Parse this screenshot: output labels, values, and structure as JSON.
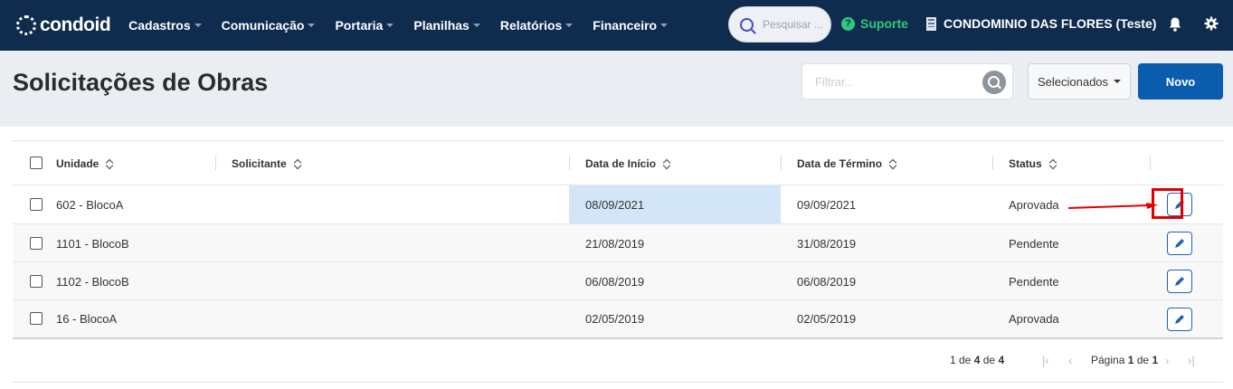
{
  "nav": {
    "logo": "condoid",
    "menu": [
      {
        "label": "Cadastros"
      },
      {
        "label": "Comunicação"
      },
      {
        "label": "Portaria"
      },
      {
        "label": "Planilhas"
      },
      {
        "label": "Relatórios"
      },
      {
        "label": "Financeiro"
      }
    ],
    "search_placeholder": "Pesquisar ...",
    "support": "Suporte",
    "condo_name": "CONDOMINIO DAS FLORES (Teste)"
  },
  "header": {
    "title": "Solicitações de Obras",
    "filter_placeholder": "Filtrar...",
    "selected_label": "Selecionados",
    "new_label": "Novo"
  },
  "table": {
    "columns": [
      "Unidade",
      "Solicitante",
      "Data de Início",
      "Data de Término",
      "Status"
    ],
    "rows": [
      {
        "unit": "602 - BlocoA",
        "requester": "",
        "start": "08/09/2021",
        "end": "09/09/2021",
        "status": "Aprovada"
      },
      {
        "unit": "1101 - BlocoB",
        "requester": "",
        "start": "21/08/2019",
        "end": "31/08/2019",
        "status": "Pendente"
      },
      {
        "unit": "1102 - BlocoB",
        "requester": "",
        "start": "06/08/2019",
        "end": "06/08/2019",
        "status": "Pendente"
      },
      {
        "unit": "16 - BlocoA",
        "requester": "",
        "start": "02/05/2019",
        "end": "02/05/2019",
        "status": "Aprovada"
      }
    ]
  },
  "pagination": {
    "range_prefix": "1 de",
    "range_count": "4",
    "range_mid": "de",
    "range_total": "4",
    "page_prefix": "Página",
    "page_current": "1",
    "page_mid": "de",
    "page_total": "1"
  },
  "colors": {
    "navbar": "#0f2c4f",
    "primary": "#0b5cad",
    "support": "#2ec97a",
    "highlight_cell": "#d3e6f8",
    "annotation": "#e00000"
  }
}
